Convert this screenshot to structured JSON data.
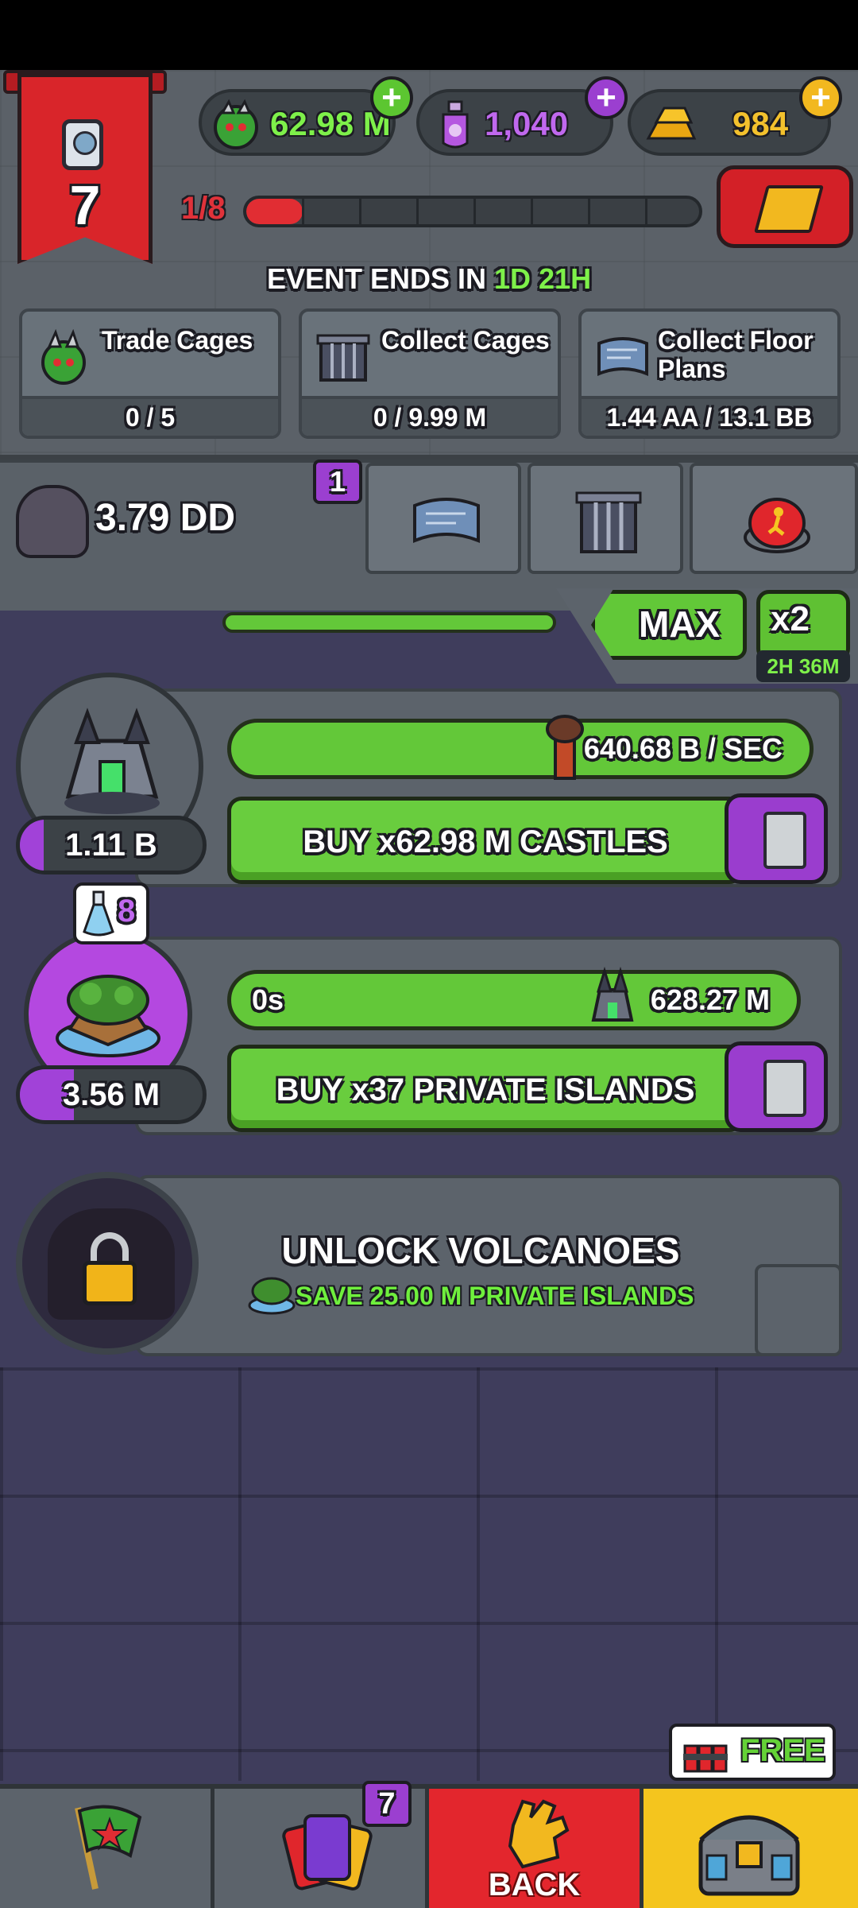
{
  "currencies": {
    "cages": "62.98 M",
    "potions": "1,040",
    "gold": "984"
  },
  "banner": {
    "level": "7"
  },
  "progress": {
    "label": "1/8",
    "fraction": 0.125
  },
  "event": {
    "prefix": "EVENT ENDS IN",
    "time": "1D 21H"
  },
  "tasks": [
    {
      "label": "Trade Cages",
      "progress": "0 / 5"
    },
    {
      "label": "Collect Cages",
      "progress": "0 / 9.99 M"
    },
    {
      "label": "Collect Floor Plans",
      "progress": "1.44 AA / 13.1 BB"
    }
  ],
  "world": {
    "value": "3.79 DD",
    "badge": "1"
  },
  "multiplier": {
    "max_label": "MAX",
    "x2_label": "x2",
    "timer": "2H 36M"
  },
  "producers": [
    {
      "name": "castles",
      "count": "1.11 B",
      "rate": "640.68 B / SEC",
      "buy_label": "BUY x62.98 M CASTLES"
    },
    {
      "name": "private-islands",
      "count": "3.56 M",
      "timer": "0s",
      "rate": "628.27 M",
      "buy_label": "BUY x37 PRIVATE ISLANDS",
      "flask_badge": "8"
    }
  ],
  "unlock": {
    "title": "UNLOCK VOLCANOES",
    "subtitle": "SAVE 25.00 M PRIVATE ISLANDS"
  },
  "nav": {
    "cards_badge": "7",
    "back_label": "BACK",
    "free_label": "FREE"
  },
  "colors": {
    "accent_green": "#62c838",
    "accent_purple": "#9b3fd0",
    "accent_red": "#d9252a",
    "gold": "#f2b81f"
  }
}
